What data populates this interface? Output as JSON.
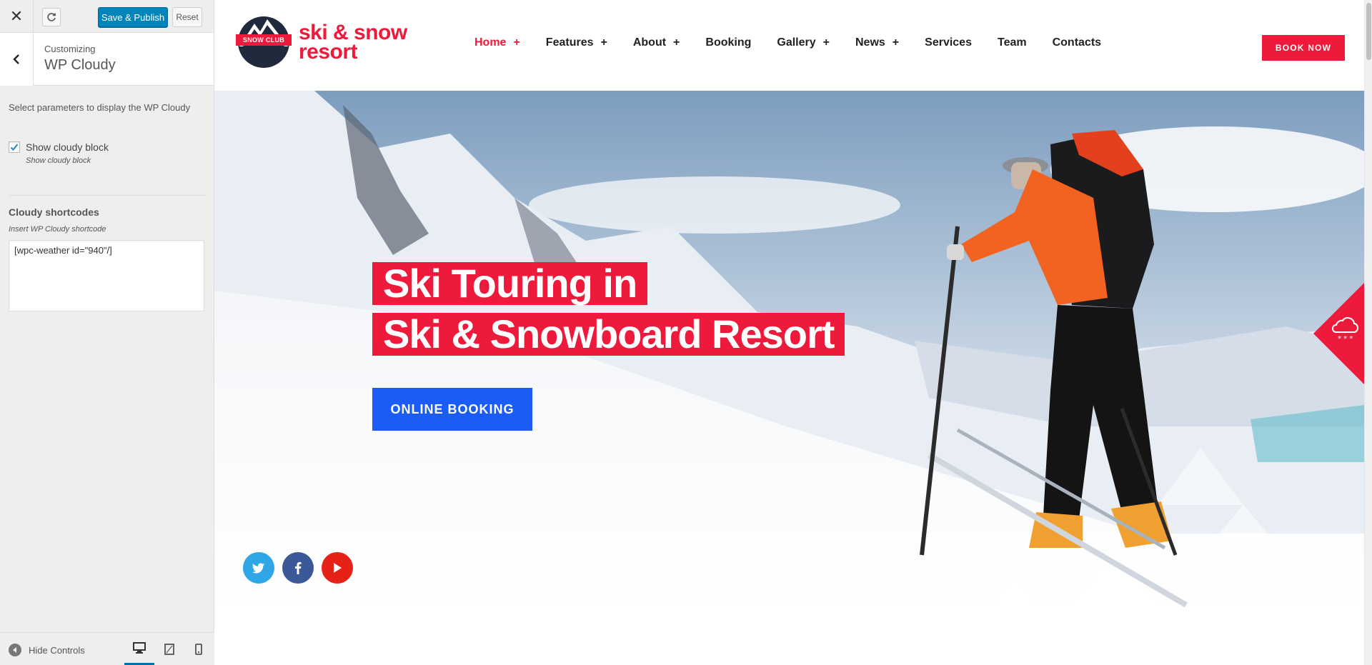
{
  "customizer": {
    "close_icon": "close-icon",
    "save_label": "Save & Publish",
    "reset_label": "Reset",
    "breadcrumb": "Customizing",
    "section_title": "WP Cloudy",
    "section_description": "Select parameters to display the WP Cloudy",
    "show_block": {
      "label": "Show cloudy block",
      "description": "Show cloudy block",
      "checked": true
    },
    "shortcodes": {
      "title": "Cloudy shortcodes",
      "description": "Insert WP Cloudy shortcode",
      "value": "[wpc-weather id=\"940\"/]"
    },
    "hide_controls_label": "Hide Controls",
    "devices": [
      "desktop",
      "tablet",
      "mobile"
    ],
    "active_device": "desktop",
    "accent_color": "#0085ba"
  },
  "site": {
    "logo_badge": "SNOW CLUB",
    "logo_line1": "ski & snow",
    "logo_line2": "resort",
    "nav": [
      {
        "label": "Home",
        "has_sub": true,
        "active": true
      },
      {
        "label": "Features",
        "has_sub": true
      },
      {
        "label": "About",
        "has_sub": true
      },
      {
        "label": "Booking",
        "has_sub": false
      },
      {
        "label": "Gallery",
        "has_sub": true
      },
      {
        "label": "News",
        "has_sub": true
      },
      {
        "label": "Services",
        "has_sub": false
      },
      {
        "label": "Team",
        "has_sub": false
      },
      {
        "label": "Contacts",
        "has_sub": false
      }
    ],
    "book_now": "BOOK NOW",
    "brand_color": "#ed1a3b",
    "hero": {
      "headline_line1": "Ski Touring in",
      "headline_line2": "Ski & Snowboard Resort",
      "cta": "ONLINE BOOKING",
      "cta_color": "#1a5cf5"
    },
    "social": [
      "twitter-icon",
      "facebook-icon",
      "youtube-icon"
    ]
  }
}
